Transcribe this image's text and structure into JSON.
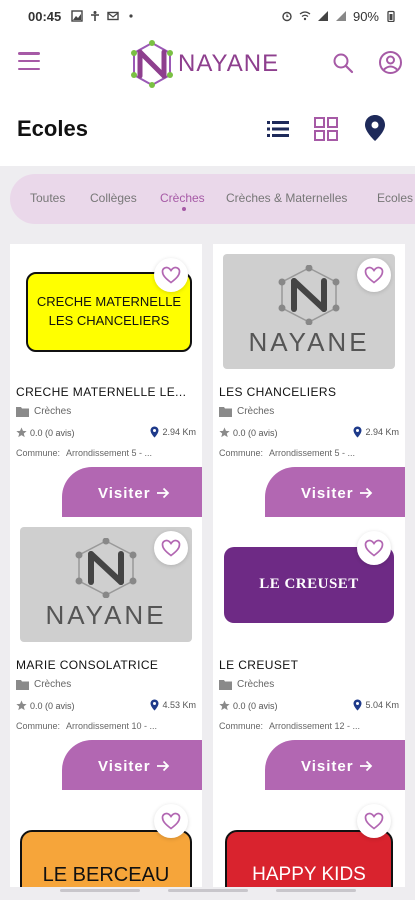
{
  "status_bar": {
    "time": "00:45",
    "battery": "90%"
  },
  "app_bar": {
    "logo_text": "NAYANE",
    "icons": [
      "menu-icon",
      "search-icon",
      "account-icon"
    ],
    "accent_color": "#a65aa6"
  },
  "page": {
    "title": "Ecoles"
  },
  "filters": {
    "items": [
      "Toutes",
      "Collèges",
      "Crèches",
      "Crèches & Maternelles",
      "Ecoles"
    ],
    "active": "Crèches"
  },
  "cards": [
    {
      "name": "CRECHE MATERNELLE LE...",
      "thumb_lines": [
        "CRECHE MATERNELLE",
        "LES CHANCELIERS"
      ],
      "category": "Crèches",
      "rating": "0.0 (0 avis)",
      "distance": "2.94 Km",
      "commune_label": "Commune:",
      "commune_value": "Arrondissement 5 - ...",
      "visit_label": "Visiter"
    },
    {
      "name": "LES CHANCELIERS",
      "thumb_word": "NAYANE",
      "category": "Crèches",
      "rating": "0.0 (0 avis)",
      "distance": "2.94 Km",
      "commune_label": "Commune:",
      "commune_value": "Arrondissement 5 - ...",
      "visit_label": "Visiter"
    },
    {
      "name": "MARIE CONSOLATRICE",
      "thumb_word": "NAYANE",
      "category": "Crèches",
      "rating": "0.0 (0 avis)",
      "distance": "4.53 Km",
      "commune_label": "Commune:",
      "commune_value": "Arrondissement 10 - ...",
      "visit_label": "Visiter"
    },
    {
      "name": "LE CREUSET",
      "thumb_text": "LE CREUSET",
      "category": "Crèches",
      "rating": "0.0 (0 avis)",
      "distance": "5.04 Km",
      "commune_label": "Commune:",
      "commune_value": "Arrondissement 12 - ...",
      "visit_label": "Visiter"
    },
    {
      "thumb_text": "LE BERCEAU"
    },
    {
      "thumb_text": "HAPPY KIDS"
    }
  ]
}
